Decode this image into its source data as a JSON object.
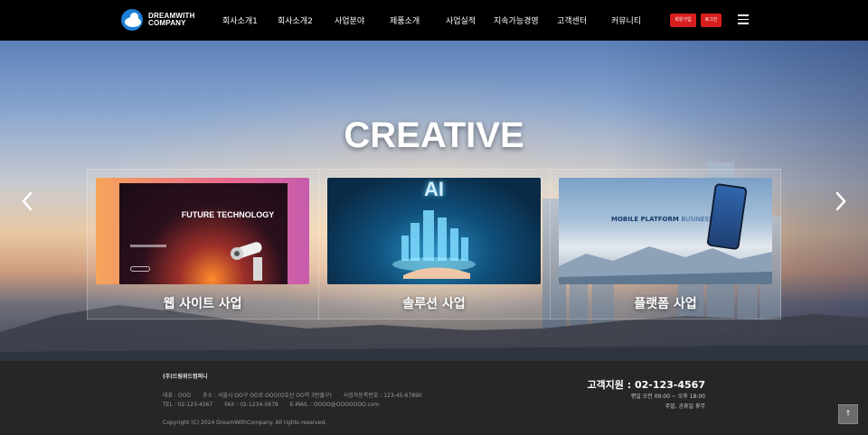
{
  "header": {
    "logo_line1": "DREAMWITH",
    "logo_line2": "COMPANY",
    "nav": [
      "회사소개1",
      "회사소개2",
      "사업분야",
      "제품소개",
      "사업실적",
      "지속가능경영",
      "고객센터",
      "커뮤니티"
    ],
    "signup_label": "회원가입",
    "login_label": "로그인",
    "menu_icon": "hamburger-menu-icon"
  },
  "hero": {
    "title": "CREATIVE",
    "prev_icon": "chevron-left-icon",
    "next_icon": "chevron-right-icon",
    "cards": [
      {
        "label": "웹 사이트 사업",
        "image_text": "FUTURE TECHNOLOGY"
      },
      {
        "label": "솔루션 사업",
        "image_text": "AI"
      },
      {
        "label": "플랫폼 사업",
        "image_text_bold": "MOBILE PLATFORM",
        "image_text_light": "BUSINESS"
      }
    ]
  },
  "footer": {
    "company": "(주)드림위드컴퍼니",
    "rep": "대표 : OOO",
    "address": "주소 : 서울시 OO구 OO로 OOO(O호선 OO역 3번출구)",
    "biz_no": "사업자등록번호 : 123-45-67890",
    "tel": "TEL : 02-123-4567",
    "fax": "FAX : 02-1234-5678",
    "email": "E-MAIL : OOOO@OOOOOOO.com",
    "copyright": "Copyright (C) 2024 DreamWithCompany. All rights reserved.",
    "support": "고객지원 : 02-123-4567",
    "hours1": "평일 오전 09:00 ~ 오후 18:00",
    "hours2": "주말, 공휴일 휴무",
    "top_icon": "arrow-up-icon"
  },
  "colors": {
    "accent_red": "#d71e1e",
    "header_bg": "#000000",
    "footer_bg": "#262626"
  }
}
